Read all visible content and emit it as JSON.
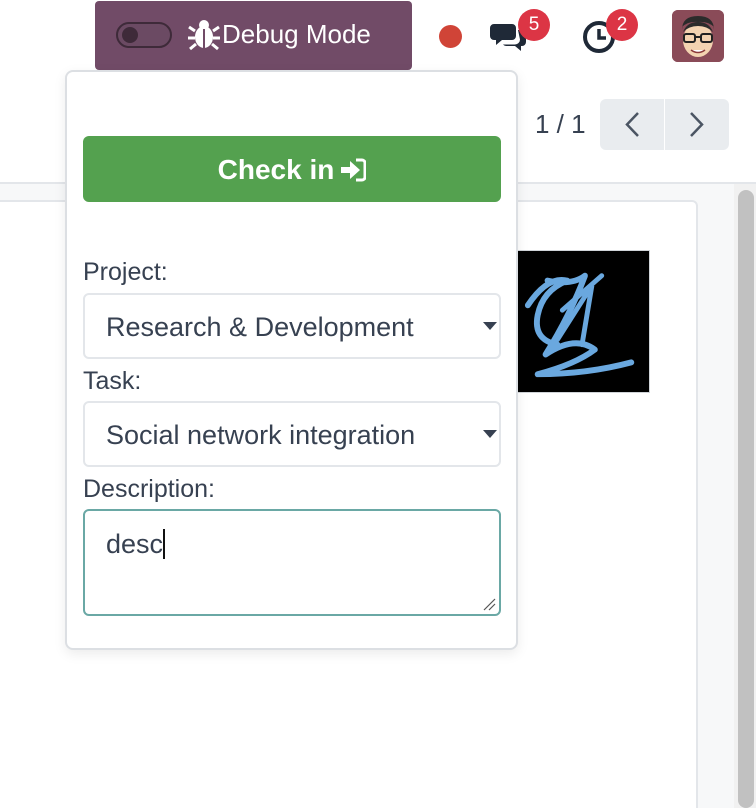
{
  "topbar": {
    "debug_label": "Debug Mode",
    "messages_count": "5",
    "activities_count": "2",
    "status_color": "#d04437",
    "brand_color": "#714b67",
    "icons": [
      "bug-icon",
      "chat-icon",
      "clock-icon",
      "avatar"
    ]
  },
  "pager": {
    "value": "1 / 1",
    "prev_icon": "chevron-left-icon",
    "next_icon": "chevron-right-icon"
  },
  "popover": {
    "checkin_label": "Check in",
    "checkin_icon": "sign-in-icon",
    "checkin_color": "#54a14f",
    "project_label": "Project:",
    "project_value": "Research & Development",
    "task_label": "Task:",
    "task_value": "Social network integration",
    "description_label": "Description:",
    "description_value": "desc"
  }
}
